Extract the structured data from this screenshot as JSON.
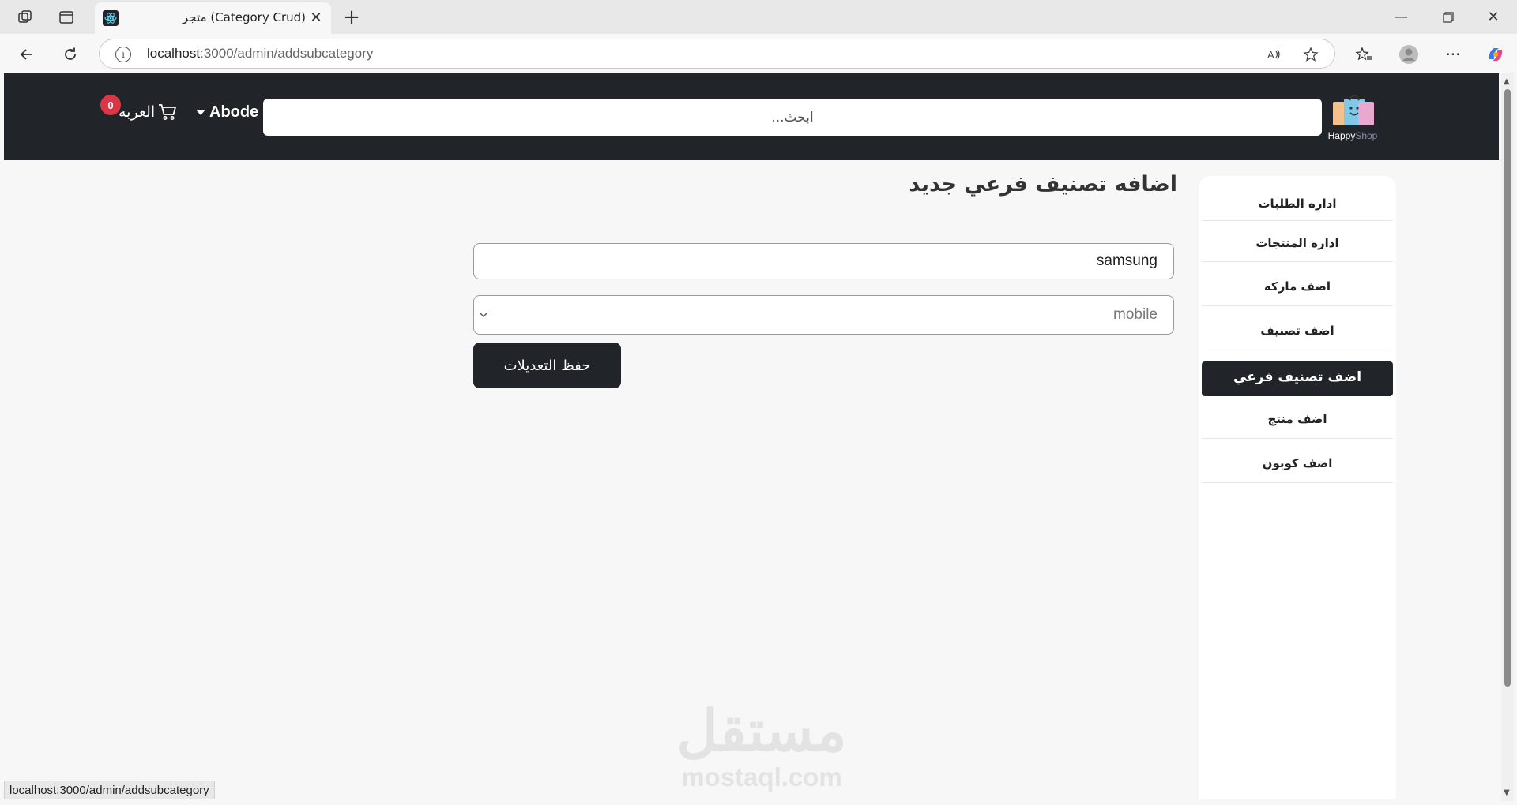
{
  "browser": {
    "tab_title": "متجر (Category Crud)",
    "url_host": "localhost",
    "url_path": ":3000/admin/addsubcategory",
    "status_url": "localhost:3000/admin/addsubcategory"
  },
  "header": {
    "logo_text_happy": "Happy",
    "logo_text_shop": "Shop",
    "search_placeholder": "ابحث...",
    "user_name": "Abode",
    "cart_label": "العربه",
    "cart_count": "0"
  },
  "sidebar": {
    "items": [
      {
        "label": "اداره الطلبات"
      },
      {
        "label": "اداره المنتجات"
      },
      {
        "label": "اضف ماركه"
      },
      {
        "label": "اضف تصنيف"
      },
      {
        "label": "اضف تصنيف فرعي",
        "active": true
      },
      {
        "label": "اضف منتج"
      },
      {
        "label": "اضف كوبون"
      }
    ]
  },
  "main": {
    "page_title": "اضافه تصنيف فرعي جديد",
    "subcategory_name_value": "samsung",
    "category_select_value": "mobile",
    "save_label": "حفظ التعديلات"
  },
  "watermark": {
    "arabic": "مستقل",
    "english": "mostaql.com"
  },
  "colors": {
    "navbar_bg": "#212529",
    "badge": "#dc3545",
    "active_item_bg": "#212529"
  }
}
